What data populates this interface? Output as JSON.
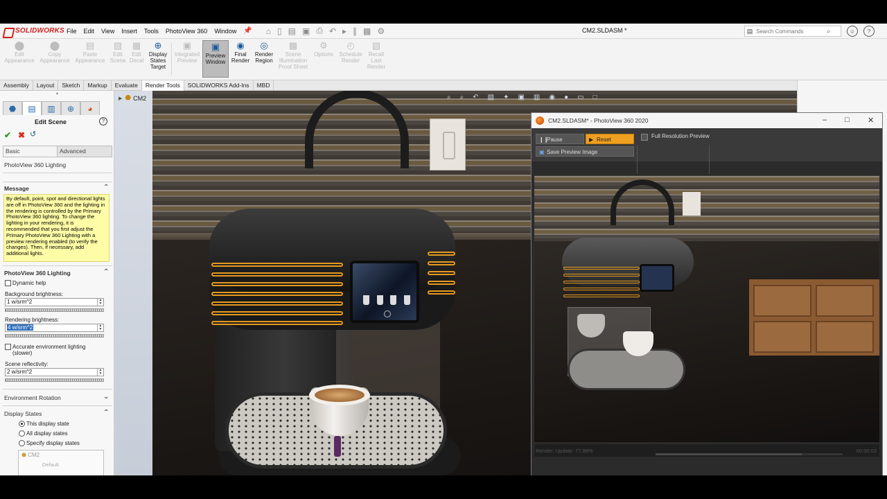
{
  "menubar": {
    "app_name": "SOLIDWORKS",
    "items": [
      "File",
      "Edit",
      "View",
      "Insert",
      "Tools",
      "PhotoView 360",
      "Window"
    ],
    "document_title": "CM2.SLDASM *",
    "search_placeholder": "Search Commands"
  },
  "ribbon": {
    "buttons": [
      {
        "label": "Edit\nAppearance",
        "icon": "appearance-icon",
        "enabled": false
      },
      {
        "label": "Copy\nAppearance",
        "icon": "copy-appearance-icon",
        "enabled": false
      },
      {
        "label": "Paste\nAppearance",
        "icon": "paste-appearance-icon",
        "enabled": false
      },
      {
        "label": "Edit\nScene",
        "icon": "scene-icon",
        "enabled": false
      },
      {
        "label": "Edit\nDecal",
        "icon": "decal-icon",
        "enabled": false
      },
      {
        "label": "Display\nStates\nTarget",
        "icon": "target-icon",
        "enabled": true
      },
      {
        "label": "Integrated\nPreview",
        "icon": "integrated-preview-icon",
        "enabled": false
      },
      {
        "label": "Preview\nWindow",
        "icon": "preview-window-icon",
        "enabled": true
      },
      {
        "label": "Final\nRender",
        "icon": "final-render-icon",
        "enabled": true
      },
      {
        "label": "Render\nRegion",
        "icon": "render-region-icon",
        "enabled": true
      },
      {
        "label": "Scene\nIllumination\nProof Sheet",
        "icon": "illumination-icon",
        "enabled": false
      },
      {
        "label": "Options",
        "icon": "options-gear-icon",
        "enabled": false
      },
      {
        "label": "Schedule\nRender",
        "icon": "schedule-icon",
        "enabled": false
      },
      {
        "label": "Recall\nLast\nRender",
        "icon": "recall-icon",
        "enabled": false
      }
    ]
  },
  "tabs": [
    "Assembly",
    "Layout",
    "Sketch",
    "Markup",
    "Evaluate",
    "Render Tools",
    "SOLIDWORKS Add-Ins",
    "MBD"
  ],
  "active_tab": "Render Tools",
  "property_manager": {
    "title": "Edit Scene",
    "subtabs": [
      "Basic",
      "Advanced"
    ],
    "caption": "PhotoView 360 Lighting",
    "message_header": "Message",
    "message": "By default, point, spot and directional lights are off in PhotoView 360 and the lighting in the rendering is controlled by the Primary PhotoView 360 lighting. To change the lighting in your rendering, it is recommended that you first adjust the Primary PhotoView 360 Lighting with a preview rendering enabled (to verify the changes). Then, if necessary, add additional lights.",
    "lighting_header": "PhotoView 360 Lighting",
    "dynamic_help": "Dynamic help",
    "background_brightness_label": "Background brightness:",
    "background_brightness": "1 w/srm^2",
    "rendering_brightness_label": "Rendering brightness:",
    "rendering_brightness": "4 w/srm^2",
    "accurate_lighting": "Accurate environment lighting\n(slower)",
    "scene_reflectivity_label": "Scene reflectivity:",
    "scene_reflectivity": "2 w/srm^2",
    "env_rotation_header": "Environment Rotation",
    "display_states_header": "Display States",
    "display_state_options": [
      "This display state",
      "All display states",
      "Specify display states"
    ],
    "tree_root": "CM2",
    "tree_child": "Default"
  },
  "feature_tree": {
    "root": "CM2"
  },
  "photoview": {
    "title": "CM2.SLDASM* - PhotoView 360 2020",
    "pause": "Pause",
    "reset": "Reset",
    "full_res": "Full Resolution Preview",
    "save_preview": "Save Preview Image",
    "status": "Render: Update: 77.98%",
    "time": "00:00:03",
    "progress_fraction": 0.78
  },
  "colors": {
    "accent_orange": "#f0a020",
    "brand_red": "#d41f1f",
    "message_yellow": "#fefca6",
    "coil_orange": "#e69a1f"
  }
}
